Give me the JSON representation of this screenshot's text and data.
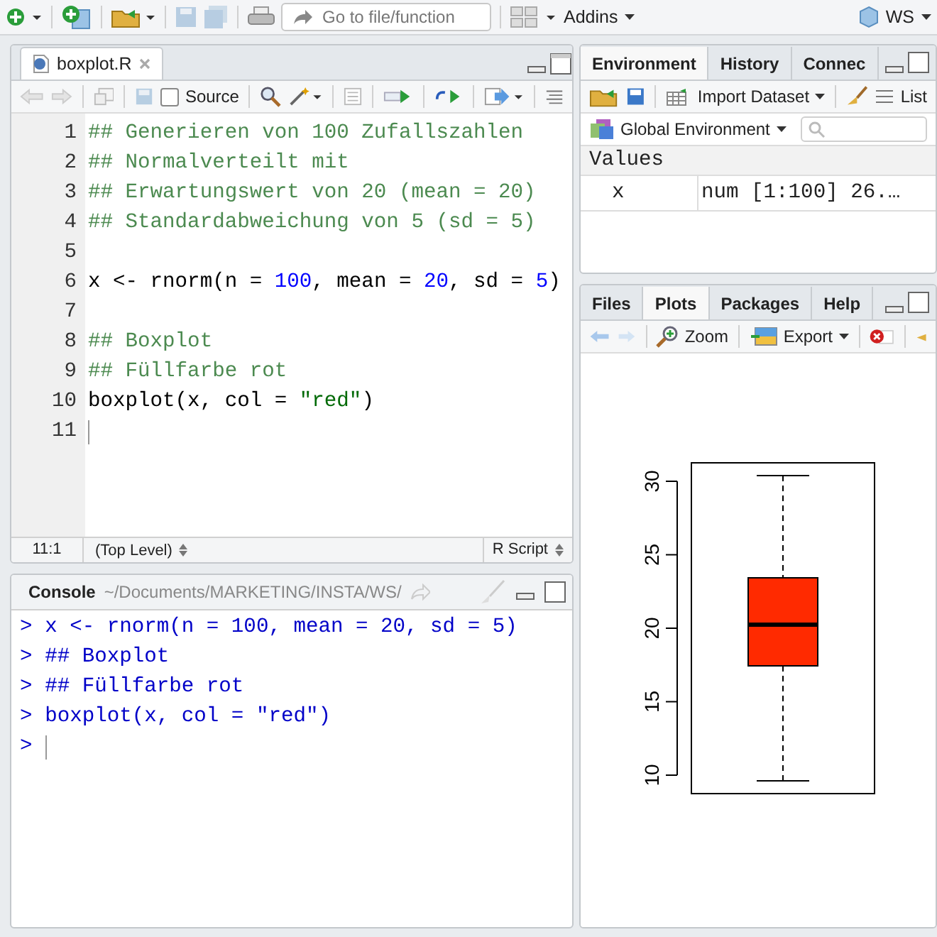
{
  "toolbar": {
    "goto_placeholder": "Go to file/function",
    "addins": "Addins",
    "project": "WS"
  },
  "editor": {
    "tab": {
      "label": "boxplot.R",
      "selected": true
    },
    "source": {
      "label": "Source",
      "checked": false
    },
    "lines": [
      {
        "number": "1",
        "tokens": [
          {
            "kind": "comment",
            "text": "## Generieren von 100 Zufallszahlen"
          }
        ]
      },
      {
        "number": "2",
        "tokens": [
          {
            "kind": "comment",
            "text": "## Normalverteilt mit"
          }
        ]
      },
      {
        "number": "3",
        "tokens": [
          {
            "kind": "comment",
            "text": "## Erwartungswert von 20 (mean = 20)"
          }
        ]
      },
      {
        "number": "4",
        "tokens": [
          {
            "kind": "comment",
            "text": "## Standardabweichung von 5 (sd = 5)"
          }
        ]
      },
      {
        "number": "5"
      },
      {
        "number": "6",
        "tokens": [
          {
            "kind": "plain",
            "text": "x <- rnorm(n = "
          },
          {
            "kind": "number",
            "text": "100"
          },
          {
            "kind": "plain",
            "text": ", mean = "
          },
          {
            "kind": "number",
            "text": "20"
          },
          {
            "kind": "plain",
            "text": ", sd = "
          },
          {
            "kind": "number",
            "text": "5"
          },
          {
            "kind": "plain",
            "text": ")"
          }
        ]
      },
      {
        "number": "7"
      },
      {
        "number": "8",
        "tokens": [
          {
            "kind": "comment",
            "text": "## Boxplot"
          }
        ]
      },
      {
        "number": "9",
        "tokens": [
          {
            "kind": "comment",
            "text": "## Füllfarbe rot"
          }
        ]
      },
      {
        "number": "10",
        "tokens": [
          {
            "kind": "plain",
            "text": "boxplot(x, col = "
          },
          {
            "kind": "string",
            "text": "\"red\""
          },
          {
            "kind": "plain",
            "text": ")"
          }
        ]
      },
      {
        "number": "11"
      }
    ],
    "status": {
      "position": "11:1",
      "scope": "(Top Level)",
      "file_type": "R Script"
    }
  },
  "console": {
    "title": "Console",
    "path": "~/Documents/MARKETING/INSTA/WS/",
    "lines": [
      {
        "prompt": ">",
        "text": "x <- rnorm(n = 100, mean = 20, sd = 5)"
      },
      {
        "prompt": ">",
        "text": "## Boxplot"
      },
      {
        "prompt": ">",
        "text": "## Füllfarbe rot"
      },
      {
        "prompt": ">",
        "text": "boxplot(x, col = \"red\")"
      },
      {
        "prompt": ">"
      }
    ]
  },
  "environment": {
    "tabs": [
      {
        "label": "Environment",
        "selected": true
      },
      {
        "label": "History",
        "selected": false
      },
      {
        "label": "Connec",
        "selected": false
      }
    ],
    "import_label": "Import Dataset",
    "list_label": "List",
    "scope": "Global Environment",
    "section": "Values",
    "rows": [
      {
        "name": "x",
        "value": "num [1:100] 26.…"
      }
    ]
  },
  "plots_pane": {
    "tabs": [
      {
        "label": "Files",
        "selected": false
      },
      {
        "label": "Plots",
        "selected": true
      },
      {
        "label": "Packages",
        "selected": false
      },
      {
        "label": "Help",
        "selected": false
      }
    ],
    "zoom": "Zoom",
    "export": "Export",
    "plot": {
      "yticks": [
        "10",
        "15",
        "20",
        "25",
        "30"
      ]
    }
  }
}
